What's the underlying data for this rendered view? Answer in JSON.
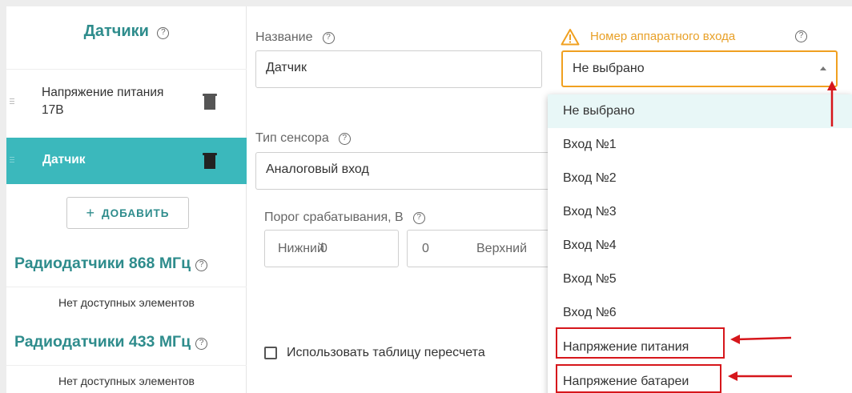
{
  "sidebar": {
    "title": "Датчики",
    "help": "?",
    "items": [
      {
        "label_line1": "Напряжение питания",
        "label_line2": "17В"
      },
      {
        "label": "Датчик"
      }
    ],
    "add_label": "ДОБАВИТЬ",
    "add_icon": "+",
    "radio_868": {
      "title": "Радиодатчики 868 МГц",
      "empty": "Нет доступных элементов"
    },
    "radio_433": {
      "title": "Радиодатчики 433 МГц",
      "empty": "Нет доступных элементов"
    }
  },
  "form": {
    "name_label": "Название",
    "name_value": "Датчик",
    "sensor_type_label": "Тип сенсора",
    "sensor_type_value": "Аналоговый вход",
    "threshold_label": "Порог срабатывания, В",
    "lower_label": "Нижний",
    "lower_value": "0",
    "upper_value": "0",
    "upper_label": "Верхний",
    "table_checkbox_label": "Использовать таблицу пересчета",
    "table_checkbox_checked": false
  },
  "hardware_input": {
    "label": "Номер аппаратного входа",
    "selected": "Не выбрано",
    "options": [
      "Не выбрано",
      "Вход №1",
      "Вход №2",
      "Вход №3",
      "Вход №4",
      "Вход №5",
      "Вход №6",
      "Напряжение питания",
      "Напряжение батареи"
    ]
  },
  "colors": {
    "accent": "#3bb8bc",
    "title": "#2e8c8c",
    "warning": "#f0a020",
    "highlight": "#d6161b"
  },
  "icons": {
    "help": "help-circle-icon",
    "warning": "warning-triangle-icon",
    "trash": "trash-icon",
    "drag": "drag-handle-icon",
    "caret": "caret-up-icon",
    "arrow": "red-arrow-annotation"
  }
}
